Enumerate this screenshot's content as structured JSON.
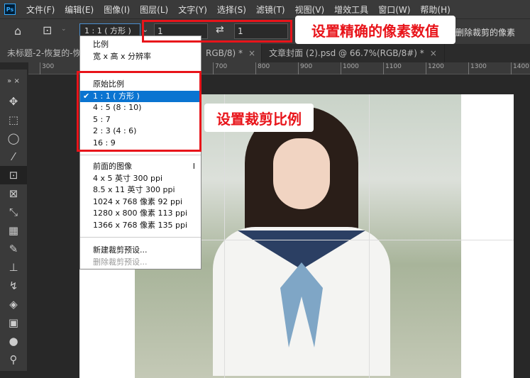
{
  "menubar": {
    "logo": "Ps",
    "items": [
      "文件(F)",
      "编辑(E)",
      "图像(I)",
      "图层(L)",
      "文字(Y)",
      "选择(S)",
      "滤镜(T)",
      "视图(V)",
      "增效工具",
      "窗口(W)",
      "帮助(H)"
    ]
  },
  "options": {
    "ratio_select": "1 : 1 ( 方形 )",
    "width_value": "1",
    "height_value": "1",
    "delete_cropped": "删除裁剪的像素"
  },
  "tabs": [
    {
      "label": "未标题-2-恢复的-恢"
    },
    {
      "label": "RGB/8) *"
    },
    {
      "label": "文章封面 (2).psd @ 66.7%(RGB/8#) *"
    }
  ],
  "ruler": [
    "300",
    "700",
    "800",
    "900",
    "1000",
    "1100",
    "1200",
    "1300",
    "1400"
  ],
  "dropdown": {
    "group1": [
      "比例",
      "宽 x 高 x 分辨率"
    ],
    "group2": [
      "原始比例",
      "1 : 1 ( 方形 )",
      "4 : 5 (8 : 10)",
      "5 : 7",
      "2 : 3 (4 : 6)",
      "16 : 9"
    ],
    "group3": [
      "前面的图像",
      "4 x 5 英寸 300 ppi",
      "8.5 x 11 英寸 300 ppi",
      "1024 x 768 像素 92 ppi",
      "1280 x 800 像素 113 ppi",
      "1366 x 768 像素 135 ppi"
    ],
    "group3_shortcut": "I",
    "group4": [
      "新建裁剪预设...",
      "删除裁剪预设..."
    ]
  },
  "callouts": {
    "pixel_values": "设置精确的像素数值",
    "crop_ratio": "设置裁剪比例"
  },
  "colors": {
    "accent": "#e8141a",
    "selection": "#0a74d1"
  }
}
